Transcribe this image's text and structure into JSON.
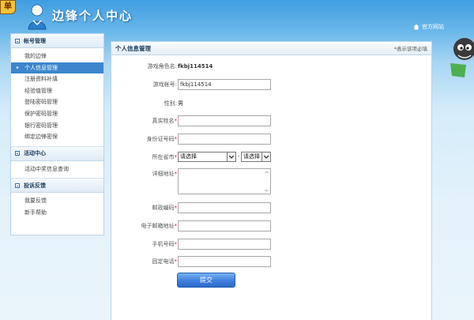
{
  "header": {
    "corner_badge": "单",
    "title": "边锋个人中心",
    "official_link": "官方网站"
  },
  "sidebar": {
    "groups": [
      {
        "title": "帐号管理",
        "items": [
          "我的边锋",
          "个人信息管理",
          "注册资料补填",
          "经验值管理",
          "登陆密码管理",
          "保护密码管理",
          "银行密码管理",
          "绑定边锋密保"
        ]
      },
      {
        "title": "活动中心",
        "items": [
          "活动中奖信息查询"
        ]
      },
      {
        "title": "投诉反馈",
        "items": [
          "我要反馈",
          "新手帮助"
        ]
      }
    ],
    "active_item": "个人信息管理"
  },
  "panel": {
    "title": "个人信息管理",
    "required_note": "*表示该项必填"
  },
  "form": {
    "game_name_label": "游戏角色名:",
    "game_name_value": "fkbj114514",
    "account_label": "游戏帐号:",
    "account_value": "fkbj114514",
    "gender_label": "性别:",
    "gender_value": "男",
    "real_name_label": "真实姓名",
    "id_number_label": "身份证号码",
    "province_city_label": "所在省市",
    "province_select": "请选择",
    "city_select": "请选择",
    "address_label": "详细地址",
    "postcode_label": "邮政编码",
    "email_label": "电子邮箱地址",
    "mobile_label": "手机号码",
    "phone_label": "固定电话",
    "required_mark": "*",
    "separator": "-",
    "submit_label": "提交"
  },
  "colors": {
    "accent": "#3b86cc",
    "button": "#3f7fde",
    "required": "#dd1122"
  }
}
